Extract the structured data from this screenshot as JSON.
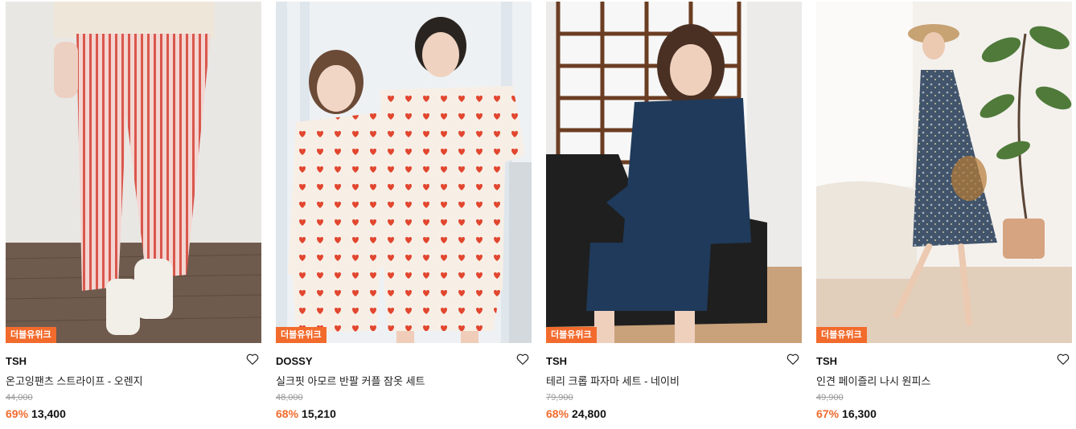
{
  "products": [
    {
      "badge": "더블유위크",
      "brand": "TSH",
      "name": "온고잉팬츠 스트라이프 - 오렌지",
      "original_price": "44,000",
      "discount": "69%",
      "price": "13,400",
      "wishlist_icon": "heart-outline-icon"
    },
    {
      "badge": "더블유위크",
      "brand": "DOSSY",
      "name": "실크핏 아모르 반팔 커플 잠옷 세트",
      "original_price": "48,000",
      "discount": "68%",
      "price": "15,210",
      "wishlist_icon": "heart-outline-icon"
    },
    {
      "badge": "더블유위크",
      "brand": "TSH",
      "name": "테리 크롭 파자마 세트 - 네이비",
      "original_price": "79,900",
      "discount": "68%",
      "price": "24,800",
      "wishlist_icon": "heart-outline-icon"
    },
    {
      "badge": "더블유위크",
      "brand": "TSH",
      "name": "인견 페이즐리 나시 원피스",
      "original_price": "49,900",
      "discount": "67%",
      "price": "16,300",
      "wishlist_icon": "heart-outline-icon"
    }
  ],
  "colors": {
    "badge": "#f26b2d",
    "discount": "#f26b2d",
    "strike": "#999999"
  }
}
